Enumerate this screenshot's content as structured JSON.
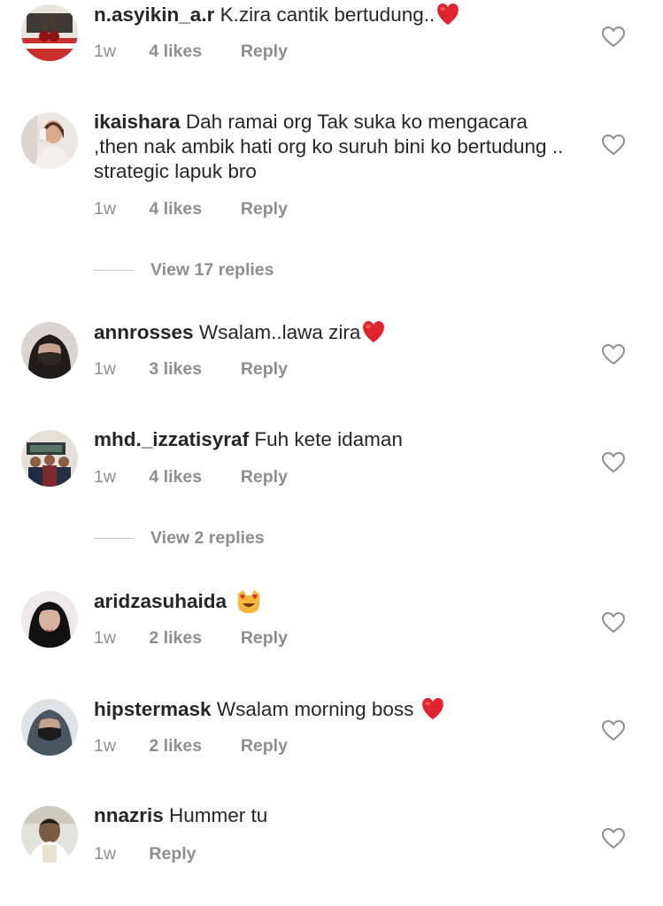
{
  "colors": {
    "text": "#262626",
    "secondary": "#8e8e8e",
    "heart_emoji": "#e0232f"
  },
  "comments": [
    {
      "username": "n.asyikin_a.r",
      "text": "K.zira cantik bertudung..",
      "emoji": "red-heart-emoji",
      "time": "1w",
      "likes": "4 likes",
      "reply": "Reply"
    },
    {
      "username": "ikaishara",
      "text": "Dah ramai org Tak suka ko mengacara ,then nak ambik hati org ko suruh bini ko bertudung .. strategic lapuk bro",
      "time": "1w",
      "likes": "4 likes",
      "reply": "Reply",
      "view_replies": "View 17 replies"
    },
    {
      "username": "annrosses",
      "text": "Wsalam..lawa zira",
      "emoji": "red-heart-emoji",
      "time": "1w",
      "likes": "3 likes",
      "reply": "Reply"
    },
    {
      "username": "mhd._izzatisyraf",
      "text": "Fuh kete idaman",
      "time": "1w",
      "likes": "4 likes",
      "reply": "Reply",
      "view_replies": "View 2 replies"
    },
    {
      "username": "aridzasuhaida",
      "text": "",
      "emoji": "heart-eyes-cat-emoji",
      "time": "1w",
      "likes": "2 likes",
      "reply": "Reply"
    },
    {
      "username": "hipstermask",
      "text": "Wsalam morning boss",
      "emoji": "red-heart-emoji",
      "time": "1w",
      "likes": "2 likes",
      "reply": "Reply"
    },
    {
      "username": "nnazris",
      "text": "Hummer tu",
      "time": "1w",
      "reply": "Reply"
    }
  ]
}
